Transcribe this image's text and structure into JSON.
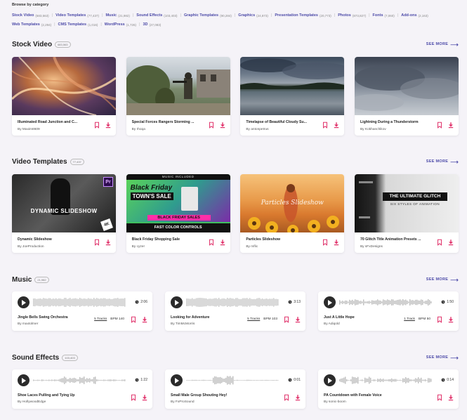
{
  "browse": {
    "title": "Browse by category",
    "categories": [
      {
        "name": "Stock Video",
        "count": "(683,563)"
      },
      {
        "name": "Video Templates",
        "count": "(77,437)"
      },
      {
        "name": "Music",
        "count": "(21,982)"
      },
      {
        "name": "Sound Effects",
        "count": "(103,403)"
      },
      {
        "name": "Graphic Templates",
        "count": "(90,284)"
      },
      {
        "name": "Graphics",
        "count": "(24,873)"
      },
      {
        "name": "Presentation Templates",
        "count": "(20,773)"
      },
      {
        "name": "Photos",
        "count": "(873,827)"
      },
      {
        "name": "Fonts",
        "count": "(7,060)"
      },
      {
        "name": "Add-ons",
        "count": "(2,163)"
      },
      {
        "name": "Web Templates",
        "count": "(2,294)"
      },
      {
        "name": "CMS Templates",
        "count": "(1,016)"
      },
      {
        "name": "WordPress",
        "count": "(1,726)"
      },
      {
        "name": "3D",
        "count": "(27,083)"
      }
    ]
  },
  "see_more": "SEE MORE",
  "stock_video": {
    "title": "Stock Video",
    "badge": "683,563",
    "items": [
      {
        "title": "Illuminated Road Junction and C...",
        "author": "By Maxim8609"
      },
      {
        "title": "Special Forces Rangers Storming ...",
        "author": "By rhoqa"
      },
      {
        "title": "Timelapse of Beautiful Cloudy Su...",
        "author": "By antonpetrus"
      },
      {
        "title": "Lightning During a Thunderstorm",
        "author": "By Kokhanchikov"
      }
    ]
  },
  "video_templates": {
    "title": "Video Templates",
    "badge": "77,437",
    "items": [
      {
        "title": "Dynamic Slideshow",
        "author": "By JoeProduction",
        "thumb_text": "DYNAMIC SLIDESHOW",
        "thumb_corner": "Pr",
        "thumb_badge": "4K"
      },
      {
        "title": "Black Friday Shopping Sale",
        "author": "By cyzer",
        "thumb_text": "Black Friday",
        "thumb_text2": "TOWN'S SALE",
        "thumb_text3": "BLACK FRIDAY SALES",
        "thumb_text4": "FAST COLOR CONTROLS",
        "thumb_top": "MUSIC INCLUDED"
      },
      {
        "title": "Particles Slideshow",
        "author": "By mflic",
        "thumb_text": "Particles Slideshow"
      },
      {
        "title": "70 Glitch Title Animation Presets ...",
        "author": "By sFxDesigns",
        "thumb_text": "THE ULTIMATE GLITCH",
        "thumb_text2": "SIX STYLES OF ANIMATION"
      }
    ]
  },
  "music": {
    "title": "Music",
    "badge": "21,982",
    "items": [
      {
        "title": "Jingle Bells Swing Orchestra",
        "author": "By maxtolmer",
        "duration": "2:06",
        "tracks": "5 Tracks",
        "bpm": "BPM 140"
      },
      {
        "title": "Looking for Adventure",
        "author": "By TimMcMorris",
        "duration": "3:13",
        "tracks": "5 Tracks",
        "bpm": "BPM 103"
      },
      {
        "title": "Just A Little Hope",
        "author": "By Adiqold",
        "duration": "1:50",
        "tracks": "1 Track",
        "bpm": "BPM 50"
      }
    ]
  },
  "sound_effects": {
    "title": "Sound Effects",
    "badge": "103,403",
    "items": [
      {
        "title": "Shoe Laces Pulling and Tying Up",
        "author": "By HollywoodEdge",
        "duration": "1:22"
      },
      {
        "title": "Small Male Group Shouting Hey!",
        "author": "By FxProSound",
        "duration": "0:01"
      },
      {
        "title": "PA Countdown with Female Voice",
        "author": "By sonic-boom",
        "duration": "0:14"
      }
    ]
  },
  "colors": {
    "accent": "#4c4aa8",
    "action_pink": "#e0336b",
    "background": "#f5f3f8"
  }
}
